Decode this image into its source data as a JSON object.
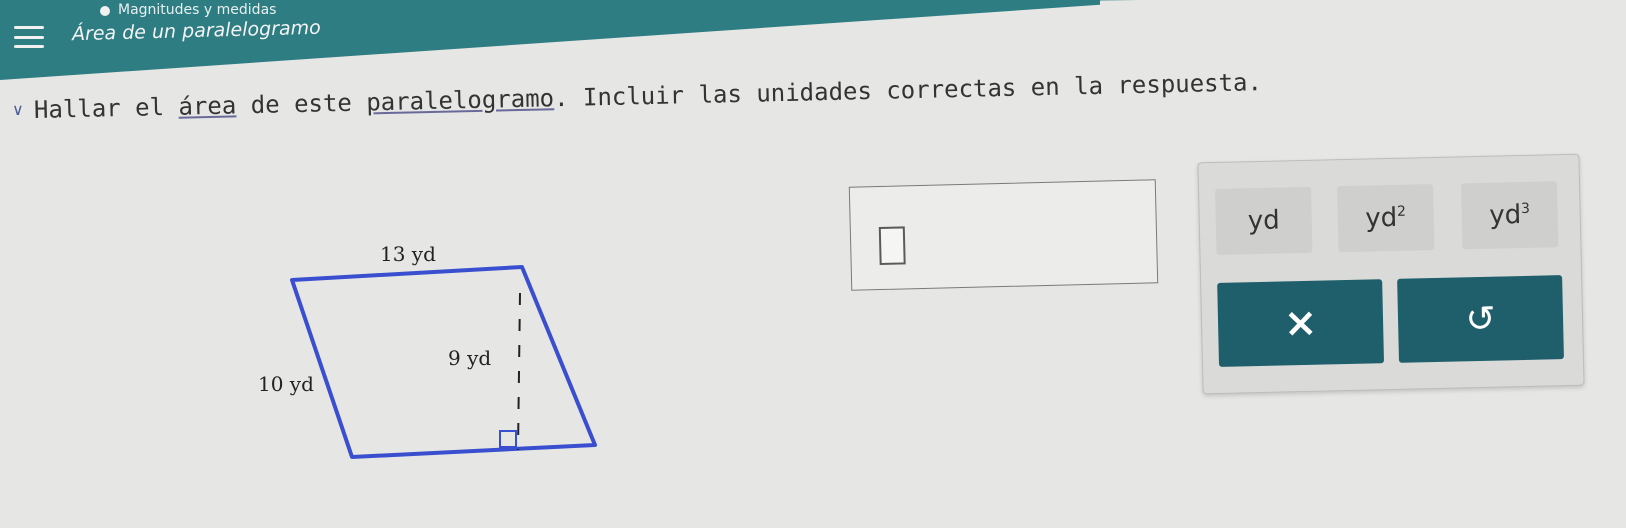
{
  "header": {
    "topic": "Magnitudes y medidas",
    "title": "Área de un paralelogramo",
    "menu_icon": "menu-icon"
  },
  "question": {
    "text_part1": "Hallar el ",
    "text_link1": "área",
    "text_part2": " de este ",
    "text_link2": "paralelogramo",
    "text_part3": ". Incluir las unidades correctas en la respuesta."
  },
  "figure": {
    "top_label": "13 yd",
    "left_label": "10 yd",
    "height_label": "9 yd",
    "stroke_color": "#3a4fd0"
  },
  "answer": {
    "value": ""
  },
  "keypad": {
    "unit1": "yd",
    "unit2_base": "yd",
    "unit2_exp": "2",
    "unit3_base": "yd",
    "unit3_exp": "3",
    "clear_icon": "×",
    "undo_icon": "↺",
    "button_color": "#1f5f6c"
  }
}
